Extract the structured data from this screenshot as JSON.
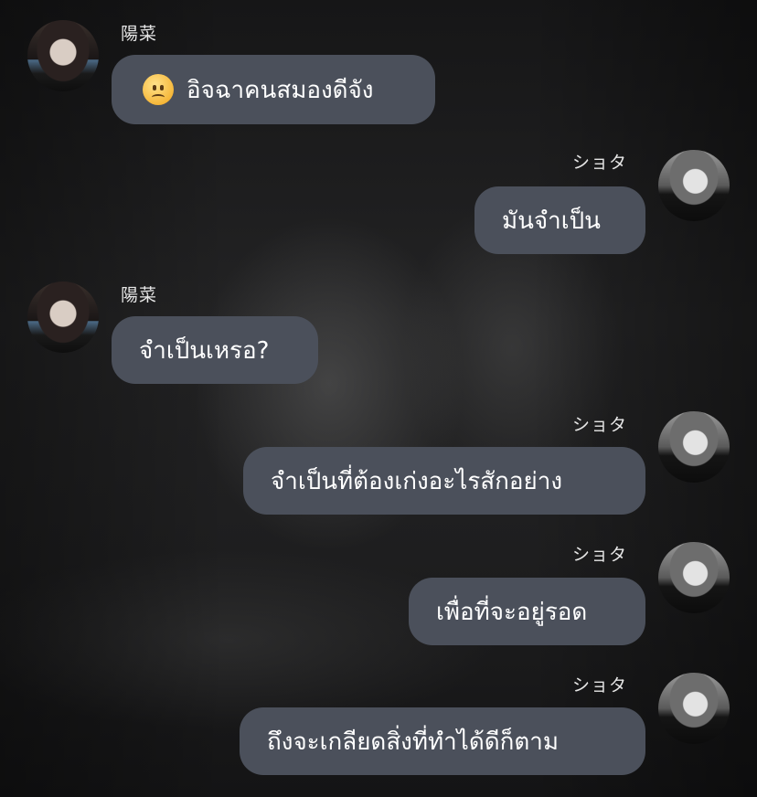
{
  "participants": {
    "hina": {
      "name": "陽菜",
      "avatar_icon": "avatar-photo-icon"
    },
    "shota": {
      "name": "ショタ",
      "avatar_icon": "avatar-photo-icon"
    }
  },
  "colors": {
    "bubble": "#4b505b",
    "text": "#ffffff",
    "name": "#e6e6e6"
  },
  "messages": [
    {
      "sender": "陽菜",
      "side": "left",
      "emoji": "frowning-face-icon",
      "text": "อิจฉาคนสมองดีจัง"
    },
    {
      "sender": "ショタ",
      "side": "right",
      "text": "มันจำเป็น"
    },
    {
      "sender": "陽菜",
      "side": "left",
      "text": "จำเป็นเหรอ?"
    },
    {
      "sender": "ショタ",
      "side": "right",
      "text": "จำเป็นที่ต้องเก่งอะไรสักอย่าง"
    },
    {
      "sender": "ショタ",
      "side": "right",
      "text": "เพื่อที่จะอยู่รอด"
    },
    {
      "sender": "ショタ",
      "side": "right",
      "text": "ถึงจะเกลียดสิ่งที่ทำได้ดีก็ตาม"
    }
  ]
}
